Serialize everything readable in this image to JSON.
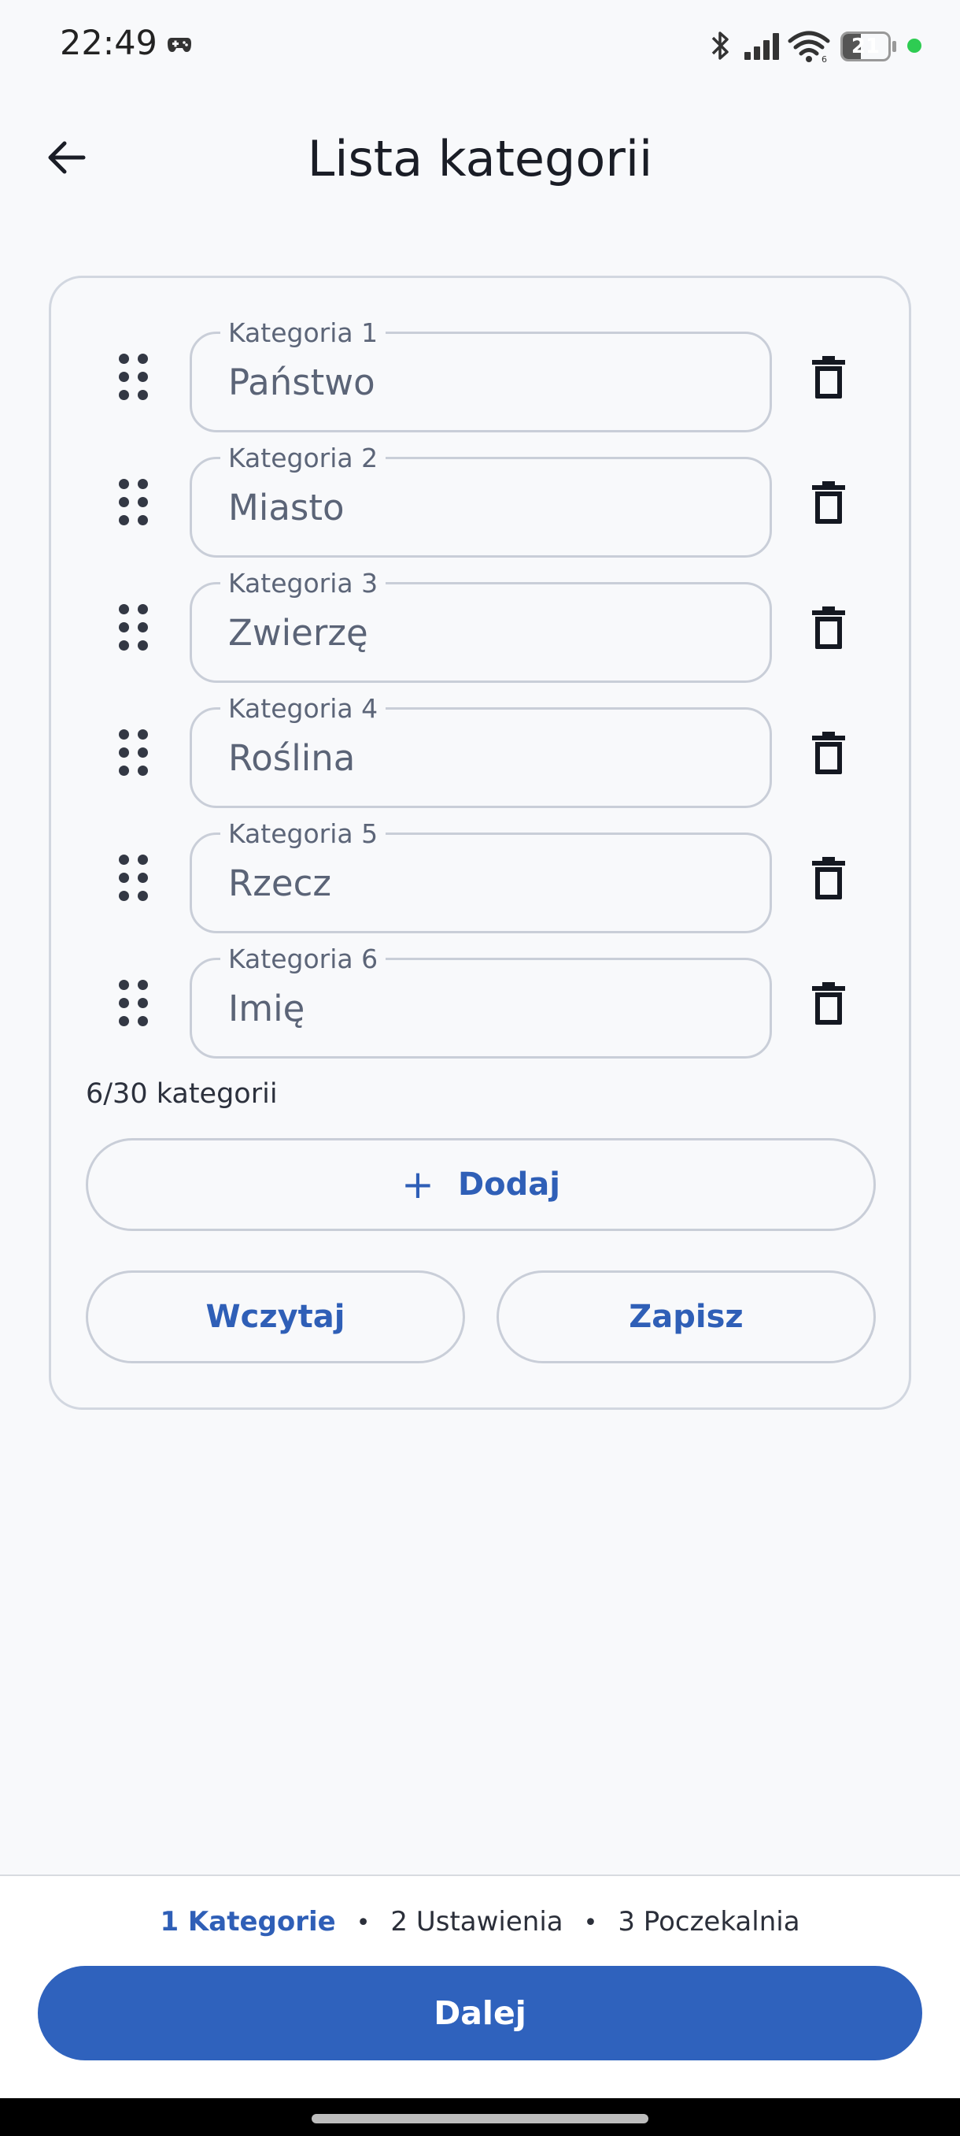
{
  "status_bar": {
    "time": "22:49",
    "battery_level": "21",
    "battery_fraction": 0.21,
    "icons": [
      "gamepad-icon",
      "bluetooth-icon",
      "signal-icon",
      "wifi-icon",
      "battery-icon",
      "green-dot"
    ]
  },
  "header": {
    "title": "Lista kategorii",
    "back_icon": "arrow-left-icon"
  },
  "categories": [
    {
      "label": "Kategoria 1",
      "value": "Państwo"
    },
    {
      "label": "Kategoria 2",
      "value": "Miasto"
    },
    {
      "label": "Kategoria 3",
      "value": "Zwierzę"
    },
    {
      "label": "Kategoria 4",
      "value": "Roślina"
    },
    {
      "label": "Kategoria 5",
      "value": "Rzecz"
    },
    {
      "label": "Kategoria 6",
      "value": "Imię"
    }
  ],
  "card": {
    "count_text": "6/30 kategorii",
    "add_label": "Dodaj",
    "add_icon": "plus-icon",
    "load_label": "Wczytaj",
    "save_label": "Zapisz"
  },
  "steps": {
    "step1": "1 Kategorie",
    "step2": "2 Ustawienia",
    "step3": "3 Poczekalnia",
    "active_step": 1
  },
  "footer": {
    "next_label": "Dalej"
  },
  "colors": {
    "primary": "#2f62bd",
    "primary_text": "#2f5fb7",
    "background": "#f8f9fb",
    "border": "#c9ced8"
  }
}
